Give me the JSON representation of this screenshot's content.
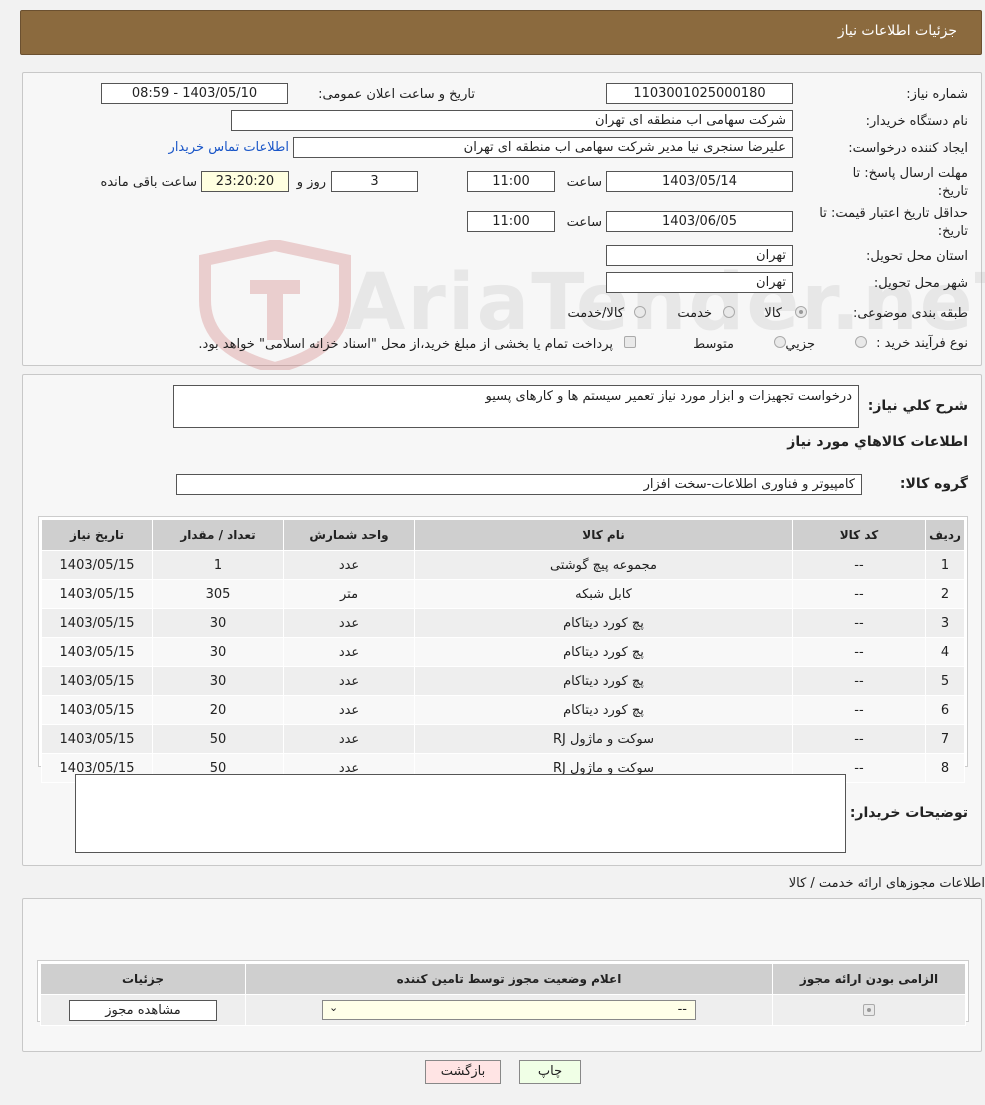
{
  "header": {
    "title": "جزئیات اطلاعات نیاز"
  },
  "form": {
    "need_number_label": "شماره نیاز:",
    "need_number": "1103001025000180",
    "announce_label": "تاریخ و ساعت اعلان عمومی:",
    "announce_value": "1403/05/10 - 08:59",
    "buyer_org_label": "نام دستگاه خریدار:",
    "buyer_org": "شرکت سهامی اب منطقه ای تهران",
    "creator_label": "ایجاد کننده درخواست:",
    "creator": "علیرضا سنجری نیا مدیر شرکت سهامی اب منطقه ای تهران",
    "contact_link": "اطلاعات تماس خریدار",
    "reply_deadline_label_1": "مهلت ارسال پاسخ: تا",
    "reply_deadline_label_2": "تاریخ:",
    "reply_date": "1403/05/14",
    "time_label": "ساعت",
    "reply_time": "11:00",
    "days": "3",
    "days_label": "روز و",
    "remaining_time": "23:20:20",
    "remaining_label": "ساعت باقی مانده",
    "price_validity_label_1": "حداقل تاریخ اعتبار قیمت: تا",
    "price_validity_label_2": "تاریخ:",
    "price_date": "1403/06/05",
    "price_time": "11:00",
    "province_label": "استان محل تحویل:",
    "province": "تهران",
    "city_label": "شهر محل تحویل:",
    "city": "تهران",
    "category_label": "طبقه بندی موضوعی:",
    "category_options": [
      "کالا",
      "خدمت",
      "کالا/خدمت"
    ],
    "process_label": "نوع فرآیند خرید :",
    "process_options": [
      "جزیي",
      "متوسط"
    ],
    "process_note": "پرداخت تمام یا بخشی از مبلغ خرید،از محل \"اسناد خزانه اسلامی\" خواهد بود."
  },
  "details": {
    "desc_label": "شرح کلي نیاز:",
    "desc_value": "درخواست تجهیزات و ابزار مورد نیاز تعمیر سیستم ها و کارهای پسیو",
    "goods_title": "اطلاعات کالاهاي مورد نياز",
    "group_label": "گروه کالا:",
    "group_value": "کامپیوتر و فناوری اطلاعات-سخت افزار",
    "columns": [
      "ردیف",
      "کد کالا",
      "نام کالا",
      "واحد شمارش",
      "تعداد / مقدار",
      "تاریخ نیاز"
    ],
    "rows": [
      [
        "1",
        "--",
        "مجموعه پیچ گوشتی",
        "عدد",
        "1",
        "1403/05/15"
      ],
      [
        "2",
        "--",
        "کابل شبکه",
        "متر",
        "305",
        "1403/05/15"
      ],
      [
        "3",
        "--",
        "پچ کورد دیتاکام",
        "عدد",
        "30",
        "1403/05/15"
      ],
      [
        "4",
        "--",
        "پچ کورد دیتاکام",
        "عدد",
        "30",
        "1403/05/15"
      ],
      [
        "5",
        "--",
        "پچ کورد دیتاکام",
        "عدد",
        "30",
        "1403/05/15"
      ],
      [
        "6",
        "--",
        "پچ کورد دیتاکام",
        "عدد",
        "20",
        "1403/05/15"
      ],
      [
        "7",
        "--",
        "سوکت و ماژول RJ",
        "عدد",
        "50",
        "1403/05/15"
      ],
      [
        "8",
        "--",
        "سوکت و ماژول RJ",
        "عدد",
        "50",
        "1403/05/15"
      ]
    ],
    "buyer_notes_label": "توضیحات خریدار:"
  },
  "permits": {
    "section_title": "اطلاعات مجوزهای ارائه خدمت / کالا",
    "columns": [
      "الزامی بودن ارائه مجوز",
      "اعلام وضعیت مجوز توسط تامین کننده",
      "جزئیات"
    ],
    "select_value": "--",
    "view_button": "مشاهده مجوز"
  },
  "actions": {
    "print": "چاپ",
    "back": "بازگشت"
  },
  "watermark": {
    "text": "AriaTender.neT"
  }
}
